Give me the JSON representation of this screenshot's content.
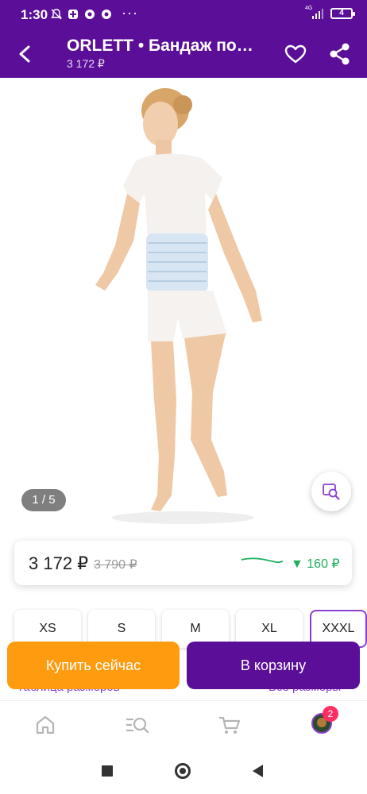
{
  "status_bar": {
    "time": "1:30",
    "dots": "···",
    "network": "4G",
    "battery": "4"
  },
  "header": {
    "title": "ORLETT • Бандаж по…",
    "subtitle": "3 172 ₽"
  },
  "gallery": {
    "counter": "1 / 5"
  },
  "price": {
    "current": "3 172 ₽",
    "old": "3 790 ₽",
    "drop": "▼ 160 ₽",
    "drop_color": "#1fae5b"
  },
  "sizes": [
    "XS",
    "S",
    "M",
    "XL",
    "XXXL"
  ],
  "selected_size": "XXXL",
  "links": {
    "size_table": "Таблица размеров",
    "all_sizes": "Все размеры"
  },
  "buttons": {
    "buy_now": "Купить сейчас",
    "add_to_cart": "В корзину"
  },
  "bottom_nav": {
    "items": [
      "home-icon",
      "catalog-search-icon",
      "cart-icon",
      "profile-avatar"
    ],
    "badge": "2"
  },
  "colors": {
    "brand": "#5b0f98",
    "accent": "#8a3fd1",
    "buy": "#ff9b0f",
    "badge": "#ff2e63"
  }
}
